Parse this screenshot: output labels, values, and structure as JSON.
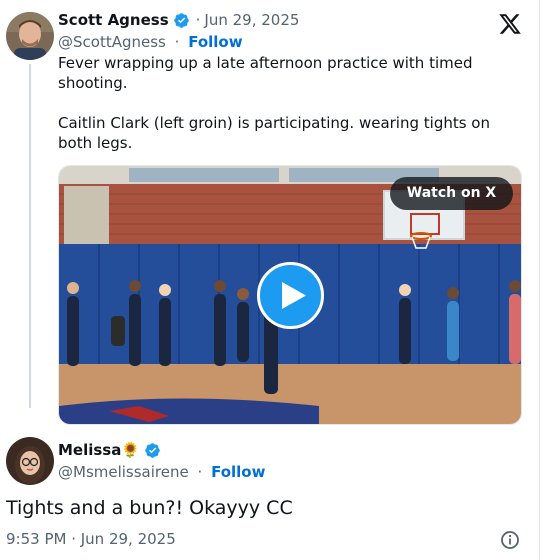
{
  "tweet": {
    "author_name": "Scott Agness",
    "author_handle": "@ScottAgness",
    "date": "Jun 29, 2025",
    "date_separator": "·",
    "follow_separator": "·",
    "follow_label": "Follow",
    "text": "Fever wrapping up a late afternoon practice with timed shooting.\n\nCaitlin Clark (left groin) is participating. wearing tights on both legs.",
    "media": {
      "watch_label": "Watch on X"
    }
  },
  "reply": {
    "author_name": "Melissa",
    "author_emoji": "🌻",
    "author_handle": "@Msmelissairene",
    "follow_separator": "·",
    "follow_label": "Follow",
    "text": "Tights and a bun?! Okayyy CC",
    "timestamp": "9:53 PM · Jun 29, 2025"
  },
  "colors": {
    "verified_blue": "#1d9bf0",
    "follow_blue": "#006fd6",
    "muted_text": "#536471"
  },
  "icons": {
    "logo": "x-logo-icon",
    "verified": "verified-badge-icon",
    "play": "play-icon",
    "info": "info-icon"
  }
}
